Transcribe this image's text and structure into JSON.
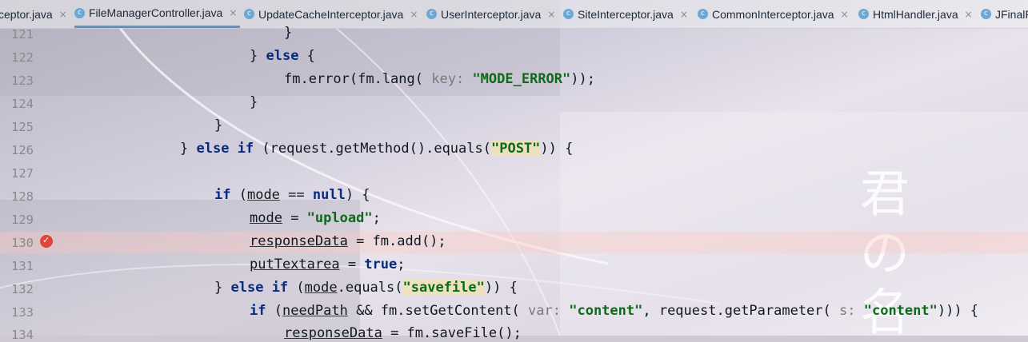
{
  "editor": {
    "tabs": [
      {
        "label": "ceptor.java",
        "icon": "",
        "active": false
      },
      {
        "label": "FileManagerController.java",
        "icon": "class-icon",
        "active": true
      },
      {
        "label": "UpdateCacheInterceptor.java",
        "icon": "class-icon",
        "active": false
      },
      {
        "label": "UserInterceptor.java",
        "icon": "class-icon",
        "active": false
      },
      {
        "label": "SiteInterceptor.java",
        "icon": "class-icon",
        "active": false
      },
      {
        "label": "CommonInterceptor.java",
        "icon": "class-icon",
        "active": false
      },
      {
        "label": "HtmlHandler.java",
        "icon": "class-icon",
        "active": false
      },
      {
        "label": "JFinalFi",
        "icon": "class-icon",
        "active": false
      }
    ],
    "close_glyph": "×",
    "class_glyph": "c"
  },
  "gutter": {
    "line_numbers": [
      "121",
      "122",
      "123",
      "124",
      "125",
      "126",
      "127",
      "128",
      "129",
      "130",
      "131",
      "132",
      "133",
      "134"
    ],
    "breakpoint_line": "130"
  },
  "code": {
    "l121_brace": "}",
    "l122_brace1": "} ",
    "l122_else": "else",
    "l122_brace2": " {",
    "l123_pre": "fm.error(fm.lang( ",
    "l123_hint": "key:",
    "l123_str": "\"MODE_ERROR\"",
    "l123_post": "));",
    "l124_brace": "}",
    "l125_brace": "}",
    "l126_a": "} ",
    "l126_else": "else",
    "l126_sp": " ",
    "l126_if": "if",
    "l126_mid": " (request.getMethod().equals(",
    "l126_str": "\"POST\"",
    "l126_end": ")) {",
    "l128_if": "if",
    "l128_open": " (",
    "l128_mode": "mode",
    "l128_eq": " == ",
    "l128_null": "null",
    "l128_end": ") {",
    "l129_mode": "mode",
    "l129_eq": " = ",
    "l129_str": "\"upload\"",
    "l129_end": ";",
    "l130_var": "responseData",
    "l130_rest": " = fm.add();",
    "l131_var": "putTextarea",
    "l131_eq": " = ",
    "l131_true": "true",
    "l131_end": ";",
    "l132_a": "} ",
    "l132_else": "else",
    "l132_sp": " ",
    "l132_if": "if",
    "l132_open": " (",
    "l132_mode": "mode",
    "l132_mid": ".equals(",
    "l132_str": "\"savefile\"",
    "l132_end": ")) {",
    "l133_if": "if",
    "l133_open": " (",
    "l133_var": "needPath",
    "l133_mid": " && fm.setGetContent( ",
    "l133_hint1": "var:",
    "l133_sp1": " ",
    "l133_str1": "\"content\"",
    "l133_mid2": ", request.getParameter( ",
    "l133_hint2": "s:",
    "l133_sp2": " ",
    "l133_str2": "\"content\"",
    "l133_end": "))) {",
    "l134_var": "responseData",
    "l134_rest": " = fm.saveFile();"
  },
  "watermark": {
    "chars": [
      "君",
      "の",
      "名"
    ]
  }
}
